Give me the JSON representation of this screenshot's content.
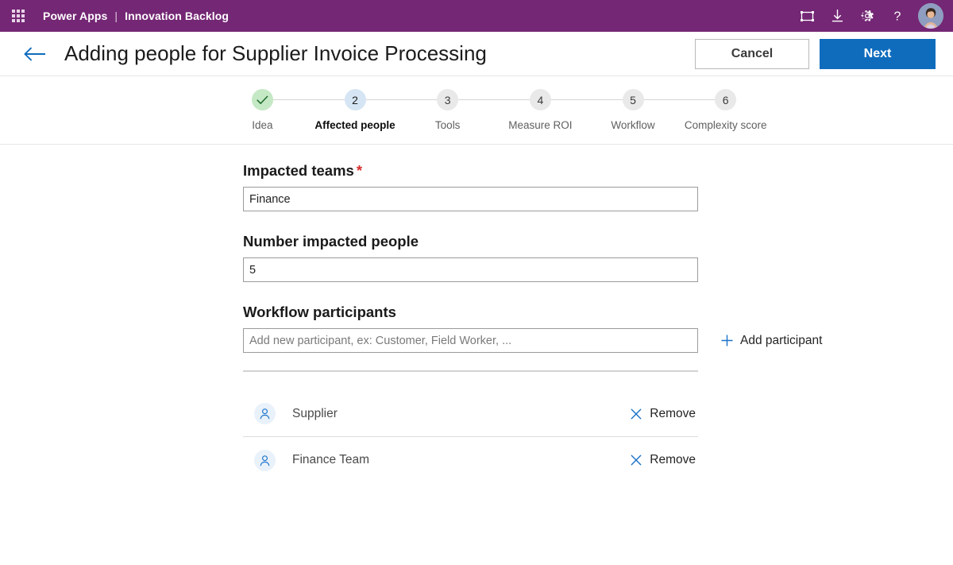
{
  "suite_bar": {
    "waffle_icon": "app-launcher-waffle-icon",
    "product": "Power Apps",
    "separator": "|",
    "app_name": "Innovation Backlog",
    "actions": [
      {
        "icon": "fit-to-screen-icon",
        "name": "fit-to-screen-button"
      },
      {
        "icon": "download-icon",
        "name": "download-button"
      },
      {
        "icon": "gear-icon",
        "name": "settings-button"
      },
      {
        "icon": "question-mark-icon",
        "name": "help-button"
      }
    ],
    "avatar_alt": "user-avatar"
  },
  "command_bar": {
    "back_icon": "back-arrow-icon",
    "title": "Adding people for Supplier Invoice Processing",
    "cancel_label": "Cancel",
    "next_label": "Next"
  },
  "stepper": {
    "steps": [
      {
        "marker": "✓",
        "label": "Idea",
        "state": "done"
      },
      {
        "marker": "2",
        "label": "Affected people",
        "state": "active"
      },
      {
        "marker": "3",
        "label": "Tools",
        "state": "todo"
      },
      {
        "marker": "4",
        "label": "Measure ROI",
        "state": "todo"
      },
      {
        "marker": "5",
        "label": "Workflow",
        "state": "todo"
      },
      {
        "marker": "6",
        "label": "Complexity score",
        "state": "todo"
      }
    ]
  },
  "form": {
    "impacted_teams": {
      "label": "Impacted teams",
      "required_marker": "*",
      "value": "Finance",
      "placeholder": ""
    },
    "number_impacted_people": {
      "label": "Number impacted people",
      "value": "5",
      "placeholder": ""
    },
    "workflow_participants": {
      "label": "Workflow participants",
      "input_value": "",
      "input_placeholder": "Add new participant, ex: Customer, Field Worker, ...",
      "add_label": "Add participant",
      "add_icon": "plus-icon",
      "remove_label": "Remove",
      "remove_icon": "close-x-icon",
      "participants": [
        {
          "name": "Supplier"
        },
        {
          "name": "Finance Team"
        }
      ]
    }
  },
  "colors": {
    "suite_bar": "#742774",
    "primary_button": "#0f6cbd",
    "link_blue": "#1a73c8",
    "required_red": "#d62d2d",
    "step_done": "#c5e8c5",
    "step_active": "#d6e5f3",
    "step_todo": "#e9e9e9"
  }
}
